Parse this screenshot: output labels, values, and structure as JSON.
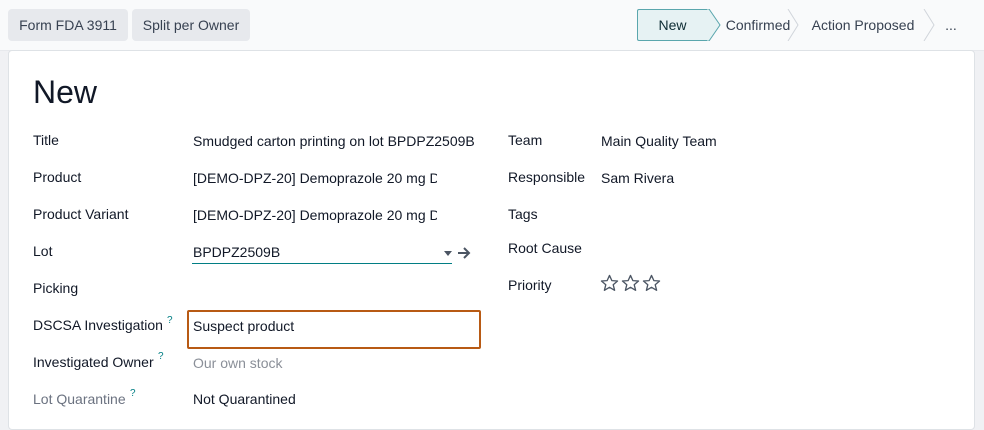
{
  "toolbar": {
    "buttons": [
      "Form FDA 3911",
      "Split per Owner"
    ]
  },
  "status": {
    "stages": [
      "New",
      "Confirmed",
      "Action Proposed",
      "..."
    ],
    "active": "New"
  },
  "record": {
    "title": "New"
  },
  "fields_left": {
    "title_label": "Title",
    "title_value": "Smudged carton printing on lot BPDPZ2509B",
    "product_label": "Product",
    "product_value": "[DEMO-DPZ-20] Demoprazole 20 mg D",
    "variant_label": "Product Variant",
    "variant_value": "[DEMO-DPZ-20] Demoprazole 20 mg D",
    "lot_label": "Lot",
    "lot_value": "BPDPZ2509B",
    "picking_label": "Picking",
    "dscsa_label": "DSCSA Investigation",
    "dscsa_value": "Suspect product",
    "owner_label": "Investigated Owner",
    "owner_value": "Our own stock",
    "quarantine_label": "Lot Quarantine",
    "quarantine_value": "Not Quarantined",
    "help_mark": "?"
  },
  "fields_right": {
    "team_label": "Team",
    "team_value": "Main Quality Team",
    "responsible_label": "Responsible",
    "responsible_value": "Sam Rivera",
    "tags_label": "Tags",
    "root_cause_label": "Root Cause",
    "priority_label": "Priority",
    "priority_stars": 0,
    "priority_max": 3
  },
  "colors": {
    "accent": "#017e84",
    "highlight": "#b85a14"
  }
}
